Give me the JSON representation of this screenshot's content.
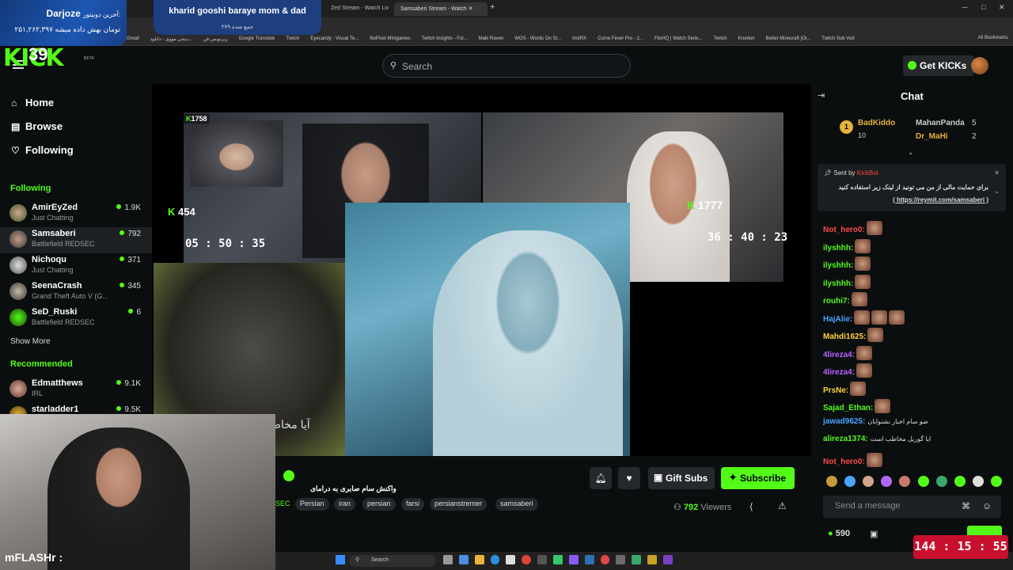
{
  "colors": {
    "accent": "#53fc18",
    "background": "#0b0e0f",
    "timer": "#c8102e"
  },
  "browser": {
    "tabs": [
      {
        "label": "Zed Stream - Watch Liv"
      },
      {
        "label": "Samsaberi Stream - Watch"
      }
    ],
    "bookmarks": [
      "Gmail",
      "دیجی مووی - دانلود...",
      "زیرنویس فن",
      "Google Translate",
      "Twitch",
      "Eyecandy - Visual Te...",
      "NoPixel Minigames",
      "Twitch Insights - Fol...",
      "Maki Raven",
      "WOS - Words On St...",
      "InstRX",
      "Curve Fever Pro - 2...",
      "FlixHQ | Watch Serie...",
      "Twitch",
      "Krunker",
      "Better Minecraft [Ol...",
      "Twitch Sub Vod"
    ],
    "all_bookmarks": "All Bookmarks"
  },
  "overlay": {
    "donor_label": "آخرین دونیتور:",
    "donor_name": "Darjoze",
    "donor_amount": "۲۵۱,۲۶۲,۳۹۷ تومان بهش داده میشه",
    "donate_title": "kharid gooshi baraye mom & dad",
    "donate_sub": "۲۷۹ جمع شده",
    "counter": "39",
    "cam_name": "mFLASHr :"
  },
  "header": {
    "logo": "KICK",
    "logo_beta": "BETA",
    "search_placeholder": "Search",
    "get_kicks": "Get KICKs"
  },
  "sidebar": {
    "nav": [
      {
        "label": "Home",
        "icon": "home-icon"
      },
      {
        "label": "Browse",
        "icon": "browse-icon"
      },
      {
        "label": "Following",
        "icon": "heart-icon"
      }
    ],
    "following_title": "Following",
    "following": [
      {
        "name": "AmirEyZed",
        "sub": "Just Chatting",
        "viewers": "1.9K"
      },
      {
        "name": "Samsaberi",
        "sub": "Battlefield REDSEC",
        "viewers": "792"
      },
      {
        "name": "Nichoqu",
        "sub": "Just Chatting",
        "viewers": "371"
      },
      {
        "name": "SeenaCrash",
        "sub": "Grand Theft Auto V (G...",
        "viewers": "345"
      },
      {
        "name": "SeD_Ruski",
        "sub": "Battlefield REDSEC",
        "viewers": "6"
      }
    ],
    "show_more": "Show More",
    "recommended_title": "Recommended",
    "recommended": [
      {
        "name": "Edmatthews",
        "sub": "IRL",
        "viewers": "9.1K"
      },
      {
        "name": "starladder1",
        "sub": "",
        "viewers": "9.5K"
      }
    ]
  },
  "video": {
    "cam1_count": "1758",
    "cam2_count": "454",
    "cam3_count": "1777",
    "timer1": "05 : 50 : 35",
    "timer2": "36 : 40 : 23",
    "caption": "آیا مخاط"
  },
  "stream": {
    "title": "واکنش سام صابری به درامای",
    "category_prefix": "SEC",
    "tags": [
      "Persian",
      "iran",
      "persian",
      "farsi",
      "persianstremer",
      "samsaberi"
    ],
    "gift_subs": "Gift Subs",
    "subscribe": "Subscribe",
    "viewers_count": "792",
    "viewers_label": "Viewers"
  },
  "taskbar": {
    "search": "Search"
  },
  "chat": {
    "title": "Chat",
    "top_gifters": [
      {
        "name": "BadKiddo",
        "count": "10"
      },
      {
        "name": "MahanPanda",
        "count": "5"
      },
      {
        "name": "Dr_MaHi",
        "count": "2"
      }
    ],
    "pinned_sent_by": "Sent by",
    "pinned_user": "KickBot",
    "pinned_text": "برای حمایت مالی از من می تونید از لینک زیر استفاده کنید",
    "pinned_link": "( https://reymit.com/samsaberi )",
    "messages": [
      {
        "user": "Not_hero0:",
        "color": "#ff4b4b",
        "msg": "",
        "emotes": 1
      },
      {
        "user": "ilyshhh:",
        "color": "#53fc18",
        "msg": "",
        "emotes": 1
      },
      {
        "user": "ilyshhh:",
        "color": "#53fc18",
        "msg": "",
        "emotes": 1
      },
      {
        "user": "ilyshhh:",
        "color": "#53fc18",
        "msg": "",
        "emotes": 1
      },
      {
        "user": "rouhi7:",
        "color": "#53fc18",
        "msg": "",
        "emotes": 1
      },
      {
        "user": "HajAlie:",
        "color": "#4aa3ff",
        "msg": "",
        "emotes": 3
      },
      {
        "user": "Mahdi1625:",
        "color": "#ffd23f",
        "msg": "",
        "emotes": 1
      },
      {
        "user": "4lireza4:",
        "color": "#b565ff",
        "msg": "",
        "emotes": 1
      },
      {
        "user": "4lireza4:",
        "color": "#b565ff",
        "msg": "",
        "emotes": 1
      },
      {
        "user": "PrsNe:",
        "color": "#ffd23f",
        "msg": "",
        "emotes": 1
      },
      {
        "user": "Sajad_Ethan:",
        "color": "#53fc18",
        "msg": "",
        "emotes": 1
      },
      {
        "user": "jawad9625:",
        "color": "#4aa3ff",
        "msg": "صو سام اخبار نشنوایان",
        "emotes": 0
      },
      {
        "user": "alireza1374:",
        "color": "#53fc18",
        "msg": "ایا گوریل مخاطب است",
        "emotes": 0
      },
      {
        "user": "Not_hero0:",
        "color": "#ff4b4b",
        "msg": "",
        "emotes": 1
      }
    ],
    "input_placeholder": "Send a message",
    "points": "590",
    "timer": "144 : 15 : 55"
  }
}
